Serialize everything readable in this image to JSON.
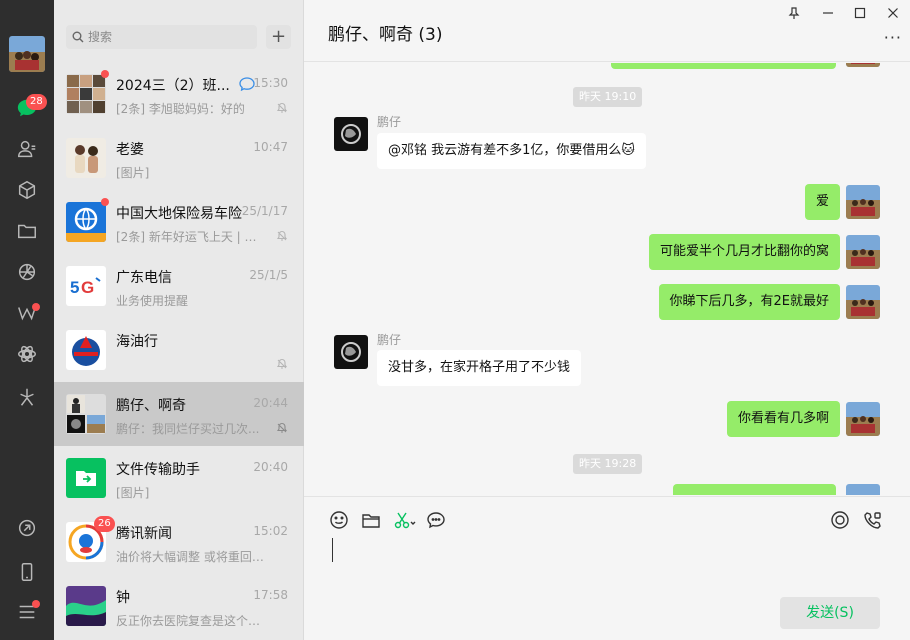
{
  "rail": {
    "chats_badge": "28",
    "items": [
      "chat-icon",
      "contacts-icon",
      "box-icon",
      "folder-icon",
      "moments-icon",
      "channels-icon",
      "mini-program-icon",
      "sparkle-icon",
      "link-icon",
      "phone-icon",
      "menu-icon"
    ]
  },
  "search": {
    "placeholder": "搜索"
  },
  "add_button": "+",
  "sessions": [
    {
      "name": "2024三（2）班...",
      "time": "15:30",
      "preview": "[2条] 李旭聪妈妈：好的",
      "unread_dot": true,
      "muted": true
    },
    {
      "name": "老婆",
      "time": "10:47",
      "preview": "[图片]",
      "unread_dot": false,
      "muted": false
    },
    {
      "name": "中国大地保险易车险",
      "time": "25/1/17",
      "preview": "[2条] 新年好运飞上天 | 大...",
      "unread_dot": true,
      "muted": true
    },
    {
      "name": "广东电信",
      "time": "25/1/5",
      "preview": "业务使用提醒",
      "unread_dot": false,
      "muted": false
    },
    {
      "name": "海油行",
      "time": "",
      "preview": "",
      "unread_dot": false,
      "muted": true
    },
    {
      "name": "鹏仔、啊奇",
      "time": "20:44",
      "preview": "鹏仔：我同烂仔买过几次...",
      "unread_dot": false,
      "muted": true,
      "active": true
    },
    {
      "name": "文件传输助手",
      "time": "20:40",
      "preview": "[图片]",
      "unread_dot": false,
      "muted": false
    },
    {
      "name": "腾讯新闻",
      "time": "15:02",
      "preview": "油价将大幅调整 或将重回“6...",
      "badge": "26",
      "muted": false
    },
    {
      "name": "钟",
      "time": "17:58",
      "preview": "反正你去医院复查是这个工...",
      "unread_dot": false,
      "muted": false
    }
  ],
  "chat": {
    "title": "鹏仔、啊奇 (3)",
    "window_controls": {
      "pin": "pin-icon",
      "minimize": "minimize-icon",
      "maximize": "maximize-icon",
      "close": "close-icon"
    },
    "more": "···",
    "timestamps": [
      "昨天 19:10",
      "昨天 19:28"
    ],
    "messages": [
      {
        "sender": "鹏仔",
        "text": "@邓铭 我云游有差不多1亿，你要借用么🐱",
        "dir": "in"
      },
      {
        "text": "爱",
        "dir": "out"
      },
      {
        "text": "可能爱半个几月才比翻你的窝",
        "dir": "out"
      },
      {
        "text": "你睇下后几多，有2E就最好",
        "dir": "out"
      },
      {
        "sender": "鹏仔",
        "text": "没甘多，在家开格子用了不少钱",
        "dir": "in"
      },
      {
        "text": "你看看有几多啊",
        "dir": "out"
      }
    ]
  },
  "composer": {
    "tools": [
      "emoji-icon",
      "file-icon",
      "scissors-icon",
      "chat-history-icon",
      "live-icon",
      "video-call-icon"
    ],
    "send_label": "发送(S)"
  },
  "colors": {
    "rail": "#2e2e2e",
    "accent": "#07c160",
    "bubble_out": "#95ec69",
    "badge": "#fa5151"
  }
}
